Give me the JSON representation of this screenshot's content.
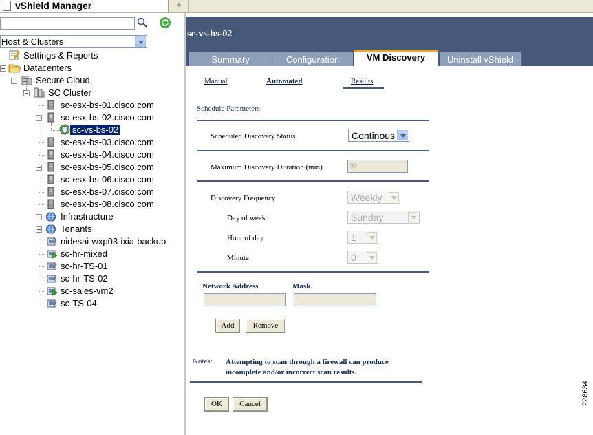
{
  "app": {
    "title": "vShield Manager",
    "new_tab_label": "+"
  },
  "sidebar": {
    "search": {
      "value": "",
      "placeholder": ""
    },
    "scope": {
      "selected": "Host & Clusters"
    },
    "tree": {
      "settings": "Settings & Reports",
      "datacenters": "Datacenters",
      "secure_cloud": "Secure Cloud",
      "sc_cluster": "SC Cluster",
      "hosts": [
        "sc-esx-bs-01.cisco.com",
        "sc-esx-bs-02.cisco.com",
        "sc-vs-bs-02",
        "sc-esx-bs-03.cisco.com",
        "sc-esx-bs-04.cisco.com",
        "sc-esx-bs-05.cisco.com",
        "sc-esx-bs-06.cisco.com",
        "sc-esx-bs-07.cisco.com",
        "sc-esx-bs-08.cisco.com"
      ],
      "infrastructure": "Infrastructure",
      "tenants": "Tenants",
      "vms": [
        "nidesai-wxp03-ixia-backup",
        "sc-hr-mixed",
        "sc-hr-TS-01",
        "sc-hr-TS-02",
        "sc-sales-vm2",
        "sc-TS-04"
      ]
    }
  },
  "main": {
    "object_title": "sc-vs-bs-02",
    "tabs": [
      "Summary",
      "Configuration",
      "VM Discovery",
      "Uninstall vShield"
    ],
    "subtabs": [
      "Manual",
      "Automated",
      "Results"
    ],
    "section_title": "Schedule Parameters",
    "fields": {
      "status_label": "Scheduled Discovery Status",
      "status_value": "Continous",
      "duration_label": "Maximum Discovery Duration (min)",
      "duration_value": "90",
      "frequency_label": "Discovery Frequency",
      "frequency_value": "Weekly",
      "day_label": "Day of week",
      "day_value": "Sunday",
      "hour_label": "Hour of day",
      "hour_value": "1",
      "minute_label": "Minute",
      "minute_value": "0"
    },
    "network": {
      "address_label": "Network Address",
      "mask_label": "Mask",
      "address_value": "",
      "mask_value": ""
    },
    "buttons": {
      "add": "Add",
      "remove": "Remove",
      "ok": "OK",
      "cancel": "Cancel"
    },
    "notes_label": "Notes:",
    "notes_text": "Attempting to scan through a firewall can produce incomplete and/or incorrect scan results."
  },
  "figure_id": "228634",
  "colors": {
    "header": "#46597a",
    "tab_inactive": "#8e9fba",
    "active_tab_accent": "#f2a42a",
    "selection": "#0a246a"
  }
}
